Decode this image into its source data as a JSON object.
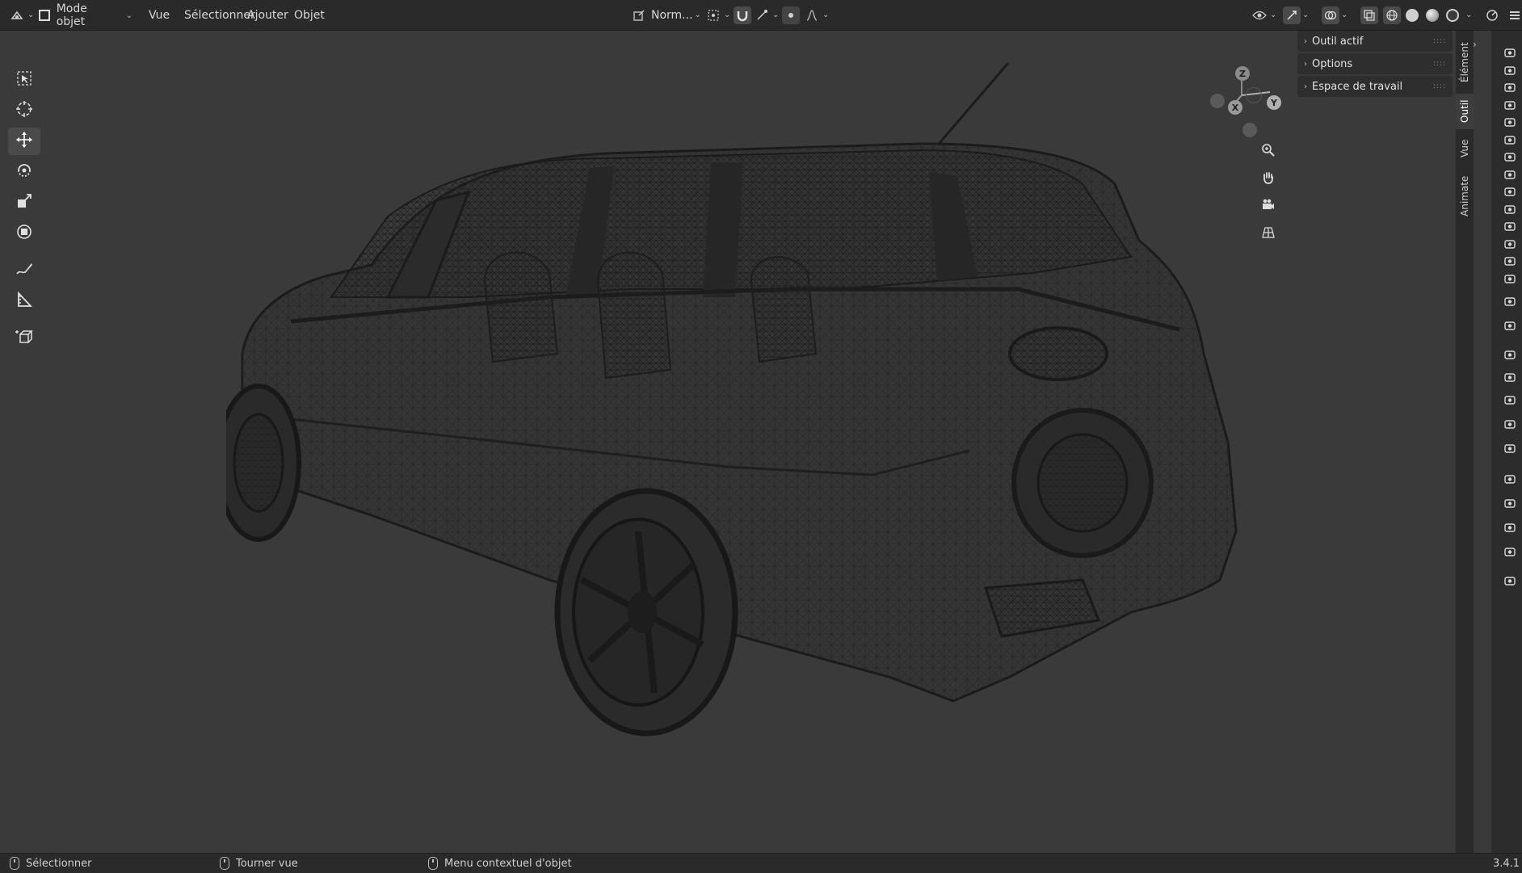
{
  "header": {
    "editor_type_icon": "3d-viewport-icon",
    "mode_label": "Mode objet",
    "menus": [
      "Vue",
      "Sélectionner",
      "Ajouter",
      "Objet"
    ],
    "orientation_label": "Norm...",
    "icons": {
      "pivot": "pivot-point-icon",
      "snap": "snap-magnet-icon",
      "snap_target": "snap-target-icon",
      "proportional": "proportional-edit-icon",
      "falloff": "falloff-curve-icon",
      "visibility": "eye-visibility-icon",
      "gizmo_toggle": "gizmo-toggle-icon",
      "overlays": "overlays-icon",
      "xray": "xray-toggle-icon",
      "shading_wire": "wireframe-shading-icon",
      "shading_solid": "solid-shading-icon",
      "shading_material": "material-preview-icon",
      "shading_rendered": "rendered-shading-icon",
      "right_tool": "scene-icon"
    }
  },
  "toolbar": {
    "tools": [
      {
        "name": "select-box-icon"
      },
      {
        "name": "cursor-icon"
      },
      {
        "name": "move-icon",
        "active": true
      },
      {
        "name": "rotate-icon"
      },
      {
        "name": "scale-icon"
      },
      {
        "name": "transform-icon"
      },
      {
        "name": "annotate-icon"
      },
      {
        "name": "measure-icon"
      },
      {
        "name": "add-cube-icon"
      }
    ]
  },
  "gizmo": {
    "x": "X",
    "y": "Y",
    "z": "Z"
  },
  "npanel": {
    "rows": [
      "Outil actif",
      "Options",
      "Espace de travail"
    ],
    "tabs": [
      "Élément",
      "Outil",
      "Vue",
      "Animate"
    ],
    "active_tab": "Outil"
  },
  "statusbar": {
    "items": [
      "Sélectionner",
      "Tourner vue",
      "Menu contextuel d'objet"
    ],
    "version": "3.4.1"
  },
  "colors": {
    "background": "#3a3a3a",
    "header": "#2a2a2a",
    "axis_x": "#9a9a9a",
    "axis_y": "#b0b0b0",
    "axis_z": "#8a8a8a"
  }
}
